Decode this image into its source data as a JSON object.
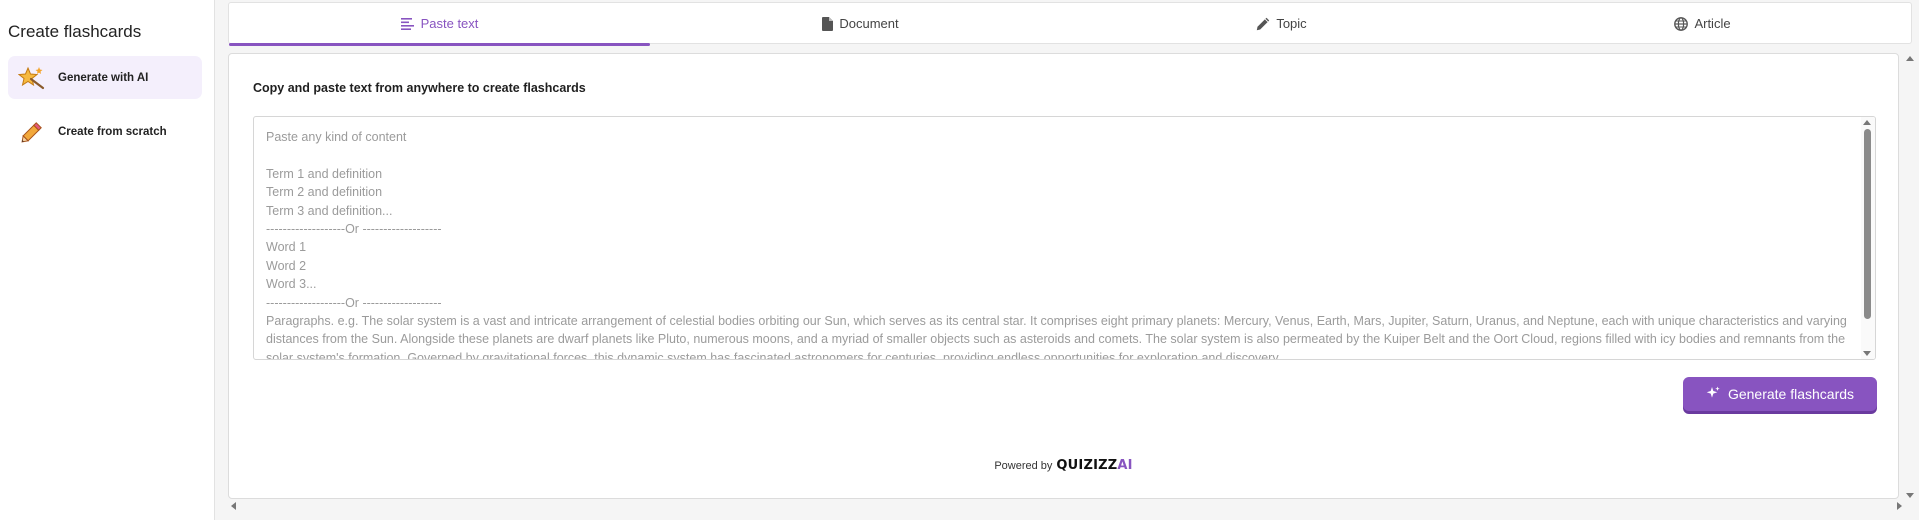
{
  "sidebar": {
    "title": "Create flashcards",
    "items": [
      {
        "label": "Generate with AI",
        "icon": "sparkle-wand-icon",
        "active": true
      },
      {
        "label": "Create from scratch",
        "icon": "pencil-icon",
        "active": false
      }
    ]
  },
  "tabs": [
    {
      "label": "Paste text",
      "icon": "text-lines-icon",
      "active": true
    },
    {
      "label": "Document",
      "icon": "document-icon",
      "active": false
    },
    {
      "label": "Topic",
      "icon": "pencil-icon",
      "active": false
    },
    {
      "label": "Article",
      "icon": "globe-icon",
      "active": false
    }
  ],
  "main": {
    "instruction": "Copy and paste text from anywhere to create flashcards",
    "textarea_placeholder": "Paste any kind of content\n\nTerm 1 and definition\nTerm 2 and definition\nTerm 3 and definition...\n-------------------Or -------------------\nWord 1\nWord 2\nWord 3...\n-------------------Or -------------------\nParagraphs. e.g. The solar system is a vast and intricate arrangement of celestial bodies orbiting our Sun, which serves as its central star. It comprises eight primary planets: Mercury, Venus, Earth, Mars, Jupiter, Saturn, Uranus, and Neptune, each with unique characteristics and varying distances from the Sun. Alongside these planets are dwarf planets like Pluto, numerous moons, and a myriad of smaller objects such as asteroids and comets. The solar system is also permeated by the Kuiper Belt and the Oort Cloud, regions filled with icy bodies and remnants from the solar system's formation. Governed by gravitational forces, this dynamic system has fascinated astronomers for centuries, providing endless opportunities for exploration and discovery.",
    "generate_label": "Generate flashcards",
    "powered_by": "Powered by",
    "brand_main": "QUIZIZZ",
    "brand_ai": "AI"
  },
  "colors": {
    "accent": "#8854c0",
    "active_bg": "#f4effc"
  }
}
